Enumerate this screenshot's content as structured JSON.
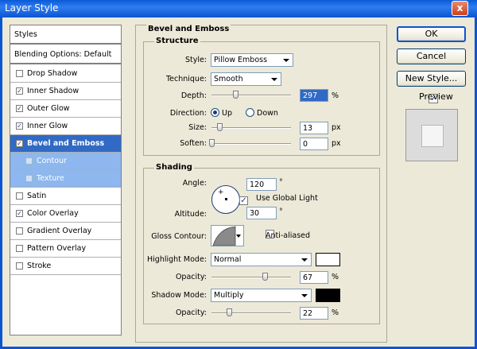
{
  "window": {
    "title": "Layer Style",
    "close_glyph": "x"
  },
  "styles_panel": {
    "header": "Styles",
    "blending": "Blending Options: Default",
    "items": [
      {
        "label": "Drop Shadow",
        "checked": false
      },
      {
        "label": "Inner Shadow",
        "checked": true
      },
      {
        "label": "Outer Glow",
        "checked": true
      },
      {
        "label": "Inner Glow",
        "checked": true
      },
      {
        "label": "Bevel and Emboss",
        "checked": true
      },
      {
        "label": "Contour",
        "checked": false
      },
      {
        "label": "Texture",
        "checked": false
      },
      {
        "label": "Satin",
        "checked": false
      },
      {
        "label": "Color Overlay",
        "checked": true
      },
      {
        "label": "Gradient Overlay",
        "checked": false
      },
      {
        "label": "Pattern Overlay",
        "checked": false
      },
      {
        "label": "Stroke",
        "checked": false
      }
    ]
  },
  "bevel": {
    "title": "Bevel and Emboss",
    "structure": {
      "title": "Structure",
      "style_label": "Style:",
      "style_value": "Pillow Emboss",
      "technique_label": "Technique:",
      "technique_value": "Smooth",
      "depth_label": "Depth:",
      "depth_value": "297",
      "depth_unit": "%",
      "depth_level": 0.3,
      "direction_label": "Direction:",
      "dir_up": "Up",
      "dir_down": "Down",
      "direction_selected": "Up",
      "size_label": "Size:",
      "size_value": "13",
      "size_unit": "px",
      "size_level": 0.1,
      "soften_label": "Soften:",
      "soften_value": "0",
      "soften_unit": "px",
      "soften_level": 0.0
    },
    "shading": {
      "title": "Shading",
      "angle_label": "Angle:",
      "angle_value": "120",
      "angle_unit": "°",
      "global_light": "Use Global Light",
      "global_light_checked": true,
      "altitude_label": "Altitude:",
      "altitude_value": "30",
      "altitude_unit": "°",
      "gloss_label": "Gloss Contour:",
      "anti_aliased": "Anti-aliased",
      "anti_aliased_checked": false,
      "highlight_label": "Highlight Mode:",
      "highlight_value": "Normal",
      "highlight_color": "#ffffff",
      "h_opacity_label": "Opacity:",
      "h_opacity_value": "67",
      "h_opacity_unit": "%",
      "h_opacity_level": 0.67,
      "shadow_label": "Shadow Mode:",
      "shadow_value": "Multiply",
      "shadow_color": "#000000",
      "s_opacity_label": "Opacity:",
      "s_opacity_value": "22",
      "s_opacity_unit": "%",
      "s_opacity_level": 0.22
    }
  },
  "buttons": {
    "ok": "OK",
    "cancel": "Cancel",
    "new_style": "New Style...",
    "preview": "Preview",
    "preview_checked": true
  }
}
